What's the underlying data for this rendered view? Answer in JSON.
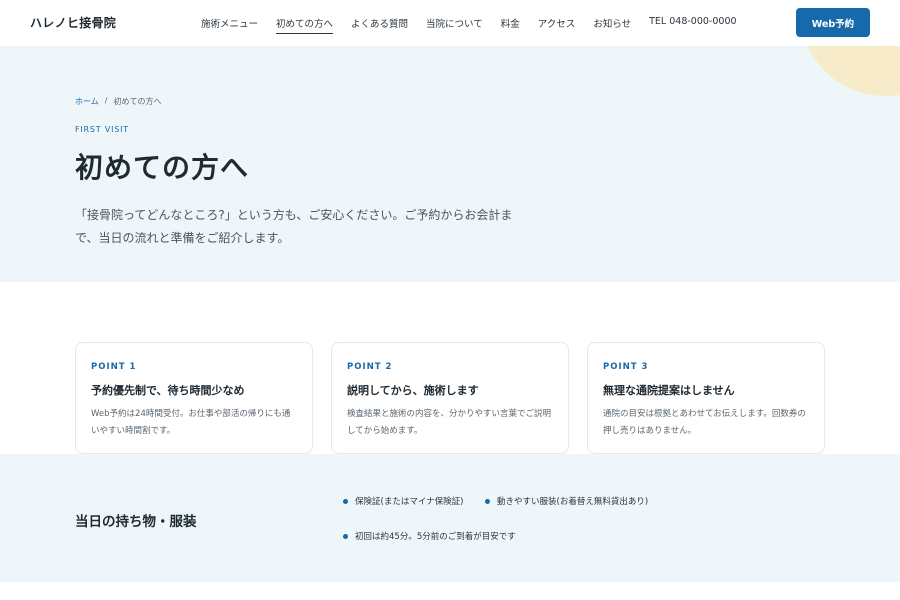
{
  "header": {
    "logo": "ハレノヒ接骨院",
    "nav": [
      {
        "label": "施術メニュー"
      },
      {
        "label": "初めての方へ"
      },
      {
        "label": "よくある質問"
      },
      {
        "label": "当院について"
      },
      {
        "label": "料金"
      },
      {
        "label": "アクセス"
      },
      {
        "label": "お知らせ"
      }
    ],
    "active_nav": "初めての方へ",
    "tel": "TEL 048-000-0000",
    "cta": "Web予約"
  },
  "hero": {
    "breadcrumb": {
      "home": "ホーム",
      "separator": "/",
      "current": "初めての方へ"
    },
    "eyebrow": "FIRST VISIT",
    "title": "初めての方へ",
    "lead": "「接骨院ってどんなところ?」という方も、ご安心ください。ご予約からお会計まで、当日の流れと準備をご紹介します。"
  },
  "points": [
    {
      "label": "POINT 1",
      "title": "予約優先制で、待ち時間少なめ",
      "desc": "Web予約は24時間受付。お仕事や部活の帰りにも通いやすい時間割です。"
    },
    {
      "label": "POINT 2",
      "title": "説明してから、施術します",
      "desc": "検査結果と施術の内容を、分かりやすい言葉でご説明してから始めます。"
    },
    {
      "label": "POINT 3",
      "title": "無理な通院提案はしません",
      "desc": "通院の目安は根拠とあわせてお伝えします。回数券の押し売りはありません。"
    }
  ],
  "bring": {
    "title": "当日の持ち物・服装",
    "items": [
      "保険証(またはマイナ保険証)",
      "動きやすい服装(お着替え無料貸出あり)",
      "初回は約45分。5分前のご到着が目安です"
    ]
  },
  "colors": {
    "accent": "#1769aa",
    "hero_bg": "#eef6fa",
    "decoration": "#f7ebca",
    "text": "#1f2a33"
  }
}
